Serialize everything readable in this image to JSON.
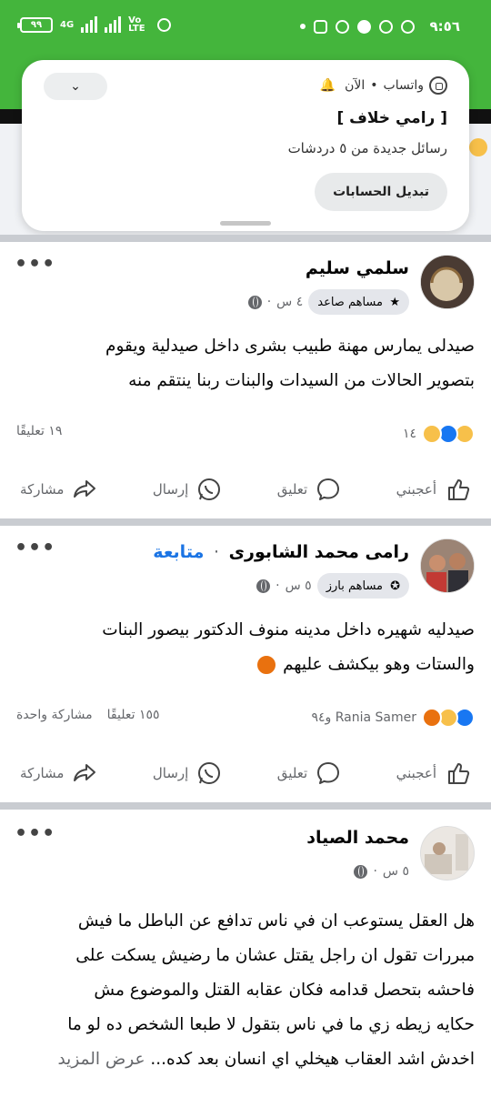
{
  "status_bar": {
    "time": "٩:٥٦",
    "battery": "٩٩",
    "network": "4G",
    "volte": "Vo LTE"
  },
  "notification": {
    "app": "واتساب",
    "when": "الآن",
    "title": "[ رامي خلاف ]",
    "body": "رسائل جديدة من ٥ دردشات",
    "button": "تبديل الحسابات"
  },
  "posts": [
    {
      "author": "سلمي سليم",
      "badge": "مساهم صاعد",
      "time": "٤ س",
      "text_lines": [
        "صيدلى يمارس مهنة طبيب بشرى داخل صيدلية ويقوم",
        "بتصوير الحالات من السيدات والبنات ربنا ينتقم منه"
      ],
      "reaction_count": "١٤",
      "comments": "١٩ تعليقًا"
    },
    {
      "author": "رامى محمد الشابورى",
      "follow": "متابعة",
      "badge": "مساهم بارز",
      "time": "٥ س",
      "text_lines": [
        "صيدليه شهيره داخل مدينه منوف الدكتور بيصور البنات",
        "والستات وهو بيكشف عليهم"
      ],
      "reaction_count": "Rania Samer و٩٤",
      "comments": "١٥٥ تعليقًا",
      "shares": "مشاركة واحدة"
    },
    {
      "author": "محمد الصياد",
      "time": "٥ س",
      "text_lines": [
        "هل العقل يستوعب ان في ناس تدافع عن الباطل ما فيش",
        "مبررات تقول ان راجل يقتل عشان ما رضيش يسكت على",
        "فاحشه بتحصل قدامه فكان عقابه القتل والموضوع مش",
        "حكايه زيطه زي ما في ناس بتقول لا طبعا الشخص ده لو ما",
        "اخدش اشد العقاب هيخلي اي انسان بعد كده..."
      ],
      "see_more": "عرض المزيد"
    }
  ],
  "actions": {
    "like": "أعجبني",
    "comment": "تعليق",
    "send": "إرسال",
    "share": "مشاركة"
  },
  "colors": {
    "status_green": "#44b53c",
    "fb_blue": "#1b74e4",
    "secondary_text": "#65676b"
  }
}
